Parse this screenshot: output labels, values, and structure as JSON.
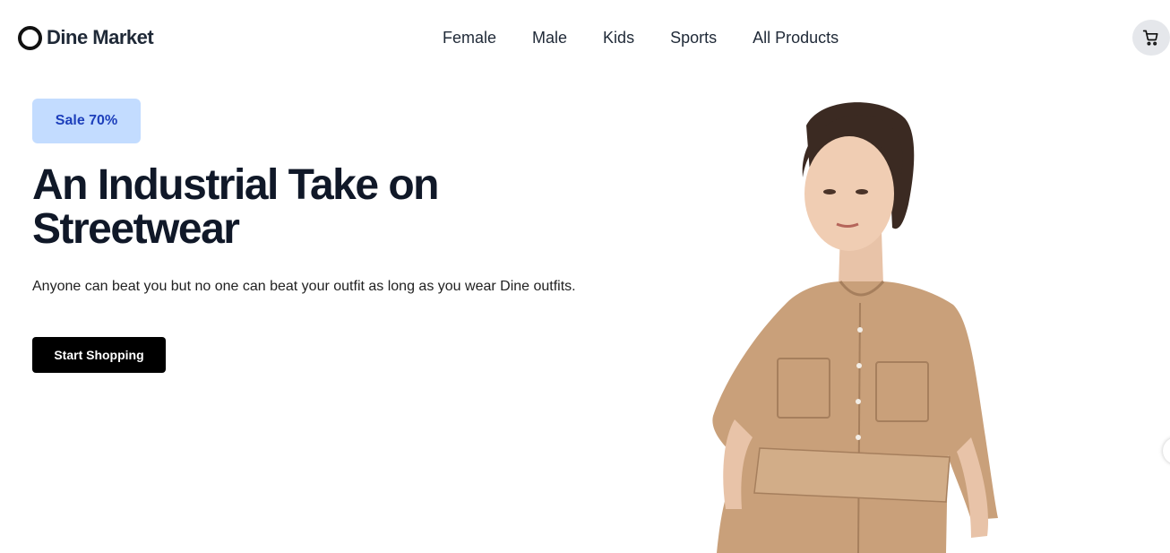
{
  "brand": {
    "name": "Dine Market",
    "logo_icon": "ring-logo-icon"
  },
  "nav": {
    "items": [
      {
        "label": "Female"
      },
      {
        "label": "Male"
      },
      {
        "label": "Kids"
      },
      {
        "label": "Sports"
      },
      {
        "label": "All Products"
      }
    ]
  },
  "cart": {
    "icon": "cart-icon",
    "background": "#e5e7eb"
  },
  "hero": {
    "badge": "Sale 70%",
    "title": "An Industrial Take on Streetwear",
    "description": "Anyone can beat you but no one can beat your outfit as long as you wear Dine outfits.",
    "cta_label": "Start Shopping",
    "image_icon": "model-photo"
  },
  "colors": {
    "badge_bg": "#c3dcff",
    "badge_text": "#1d3fbb",
    "cta_bg": "#000000",
    "title": "#101828",
    "dress": "#c9a07a"
  }
}
